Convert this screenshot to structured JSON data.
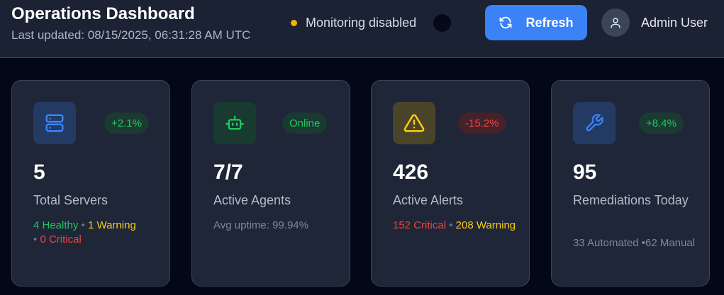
{
  "header": {
    "title": "Operations Dashboard",
    "last_updated": "Last updated: 08/15/2025, 06:31:28 AM UTC",
    "monitoring_status": "Monitoring disabled",
    "refresh_label": "Refresh",
    "user_name": "Admin User"
  },
  "cards": [
    {
      "icon": "server-icon",
      "badge": "+2.1%",
      "value": "5",
      "label": "Total Servers",
      "detail": {
        "healthy": "4 Healthy",
        "sep1": "•",
        "warning": "1 Warning",
        "sep2": "•",
        "critical": "0 Critical"
      }
    },
    {
      "icon": "bot-icon",
      "badge": "Online",
      "value": "7/7",
      "label": "Active Agents",
      "detail": {
        "text": "Avg uptime: 99.94%"
      }
    },
    {
      "icon": "warning-triangle-icon",
      "badge": "-15.2%",
      "value": "426",
      "label": "Active Alerts",
      "detail": {
        "critical": "152 Critical",
        "sep": "•",
        "warning": "208 Warning"
      }
    },
    {
      "icon": "wrench-icon",
      "badge": "+8.4%",
      "value": "95",
      "label": "Remediations Today",
      "detail": {
        "text": "33 Automated •62 Manual"
      }
    }
  ],
  "colors": {
    "background": "#030816",
    "header_bg": "#1a2233",
    "card_bg": "#1e2637",
    "accent_blue": "#3b82f6",
    "success": "#22c55e",
    "warning": "#facc15",
    "danger": "#ef4444",
    "status_dot": "#f4b400"
  }
}
